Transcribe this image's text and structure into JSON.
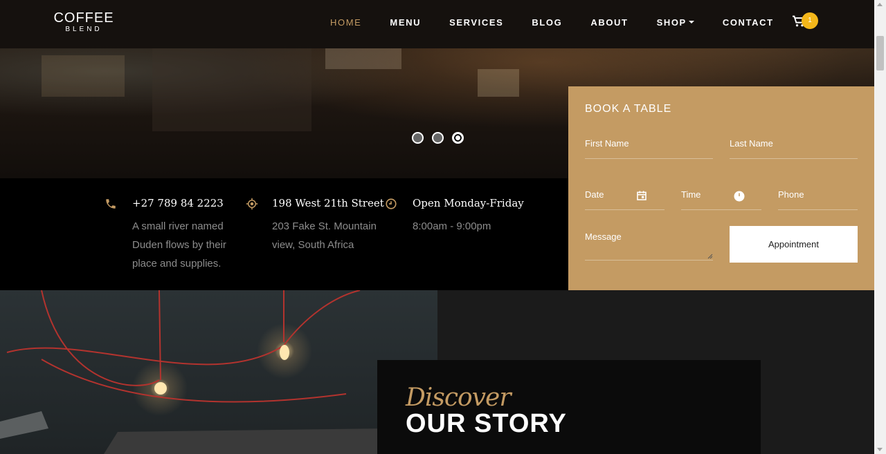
{
  "brand": {
    "top": "COFFEE",
    "bottom": "BLEND"
  },
  "nav": {
    "items": [
      {
        "label": "HOME",
        "active": true
      },
      {
        "label": "MENU"
      },
      {
        "label": "SERVICES"
      },
      {
        "label": "BLOG"
      },
      {
        "label": "ABOUT"
      },
      {
        "label": "SHOP"
      },
      {
        "label": "CONTACT"
      }
    ],
    "cart_count": "1"
  },
  "carousel": {
    "slides": 3,
    "active_index": 2
  },
  "info": [
    {
      "icon": "phone-icon",
      "heading": "+27 789 84 2223",
      "text": "A small river named Duden flows by their place and supplies."
    },
    {
      "icon": "location-icon",
      "heading": "198 West 21th Street",
      "text": "203 Fake St. Mountain view, South Africa"
    },
    {
      "icon": "clock-icon",
      "heading": "Open Monday-Friday",
      "text": "8:00am - 9:00pm"
    }
  ],
  "booking": {
    "title": "BOOK A TABLE",
    "first_name": "First Name",
    "last_name": "Last Name",
    "date": "Date",
    "time": "Time",
    "phone": "Phone",
    "message": "Message",
    "submit": "Appointment"
  },
  "story": {
    "script": "Discover",
    "title": "OUR STORY"
  },
  "colors": {
    "accent": "#c49b63",
    "nav_bg": "#15110e",
    "badge": "#f4b71a"
  }
}
